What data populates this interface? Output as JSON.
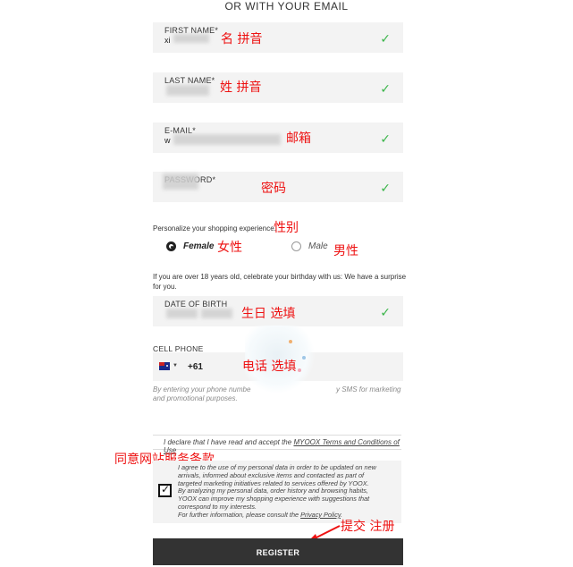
{
  "header": {
    "title": "OR WITH YOUR EMAIL"
  },
  "fields": {
    "first_name": {
      "label": "FIRST NAME*",
      "value": "xi",
      "annotation": "名 拼音"
    },
    "last_name": {
      "label": "LAST NAME*",
      "value": "",
      "annotation": "姓 拼音"
    },
    "email": {
      "label": "E-MAIL*",
      "value": "w",
      "annotation": "邮箱"
    },
    "password": {
      "label": "PASSWORD*",
      "value": "",
      "annotation": "密码"
    },
    "dob": {
      "label": "DATE OF BIRTH",
      "value": "",
      "annotation": "生日 选填"
    },
    "phone": {
      "label": "CELL PHONE",
      "prefix": "+61",
      "annotation": "电话 选填"
    }
  },
  "check_glyph": "✓",
  "personalize": {
    "text": "Personalize your shopping experience.",
    "annotation": "性别"
  },
  "gender": {
    "female_label": "Female",
    "female_annotation": "女性",
    "male_label": "Male",
    "male_annotation": "男性",
    "selected": "Female"
  },
  "birthday_note": {
    "line1": "If you are over 18 years old, celebrate your birthday with us: We have a surprise",
    "line2": "for you."
  },
  "phone_note": {
    "line1a": "By entering your phone numbe",
    "line1b": "y SMS for marketing",
    "line2": "and promotional purposes."
  },
  "terms": {
    "text": "I declare that I have read and accept the ",
    "link": "MYOOX Terms and Conditions of Use",
    "annotation": "同意网站服务条款"
  },
  "consent": {
    "checked": true,
    "lines": [
      "I agree to the use of my personal data in order to be updated on new",
      "arrivals, informed about exclusive items and contacted as part of",
      "targeted marketing initiatives related to services offered by YOOX.",
      "By analyzing my personal data, order history and browsing habits,",
      "YOOX can improve my shopping experience with suggestions that",
      "correspond to my interests."
    ],
    "policy_prefix": "For further information, please consult the ",
    "policy_link": "Privacy Policy",
    "policy_suffix": "."
  },
  "submit": {
    "label": "REGISTER",
    "annotation": "提交 注册"
  },
  "colors": {
    "check": "#3bb54a",
    "annotation": "#ee1111",
    "button": "#333333",
    "field_bg": "#f3f3f3"
  }
}
